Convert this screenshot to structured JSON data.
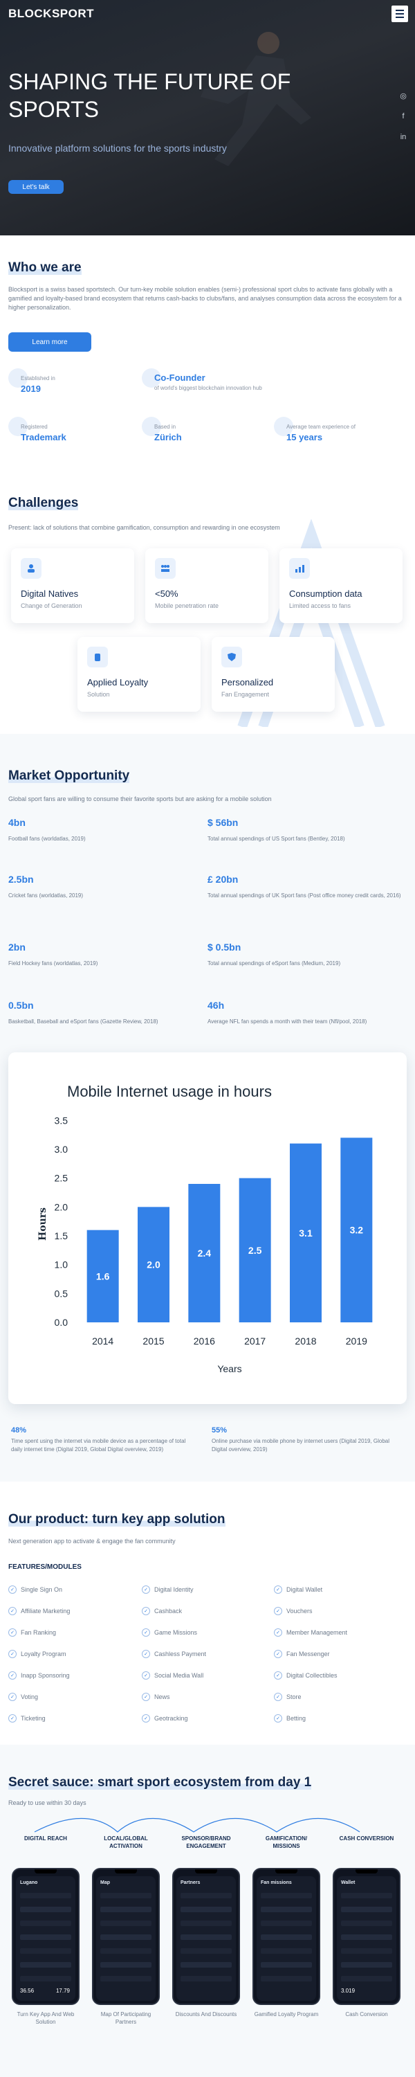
{
  "brand": {
    "logo": "BLOCKSPORT"
  },
  "hero": {
    "title": "SHAPING THE FUTURE OF SPORTS",
    "subtitle": "Innovative platform solutions for the sports industry",
    "cta": "Let's talk"
  },
  "about": {
    "title": "Who we are",
    "body": "Blocksport is a swiss based sportstech. Our turn-key mobile solution enables (semi-) professional sport clubs to activate fans globally with a gamified and loyalty-based brand ecosystem that returns cash-backs to clubs/fans, and analyses consumption data across the ecosystem for a higher personalization.",
    "cta": "Learn more",
    "stats": [
      {
        "label": "Established in",
        "value": "2019"
      },
      {
        "label": "Co-Founder",
        "value": "of world's biggest blockchain innovation hub"
      },
      {
        "label": "Registered",
        "value": "Trademark"
      },
      {
        "label": "Based in",
        "value": "Zürich"
      },
      {
        "label": "Average team experience of",
        "value": "15 years"
      }
    ]
  },
  "challenges": {
    "title": "Challenges",
    "intro": "Present: lack of solutions that combine gamification, consumption and rewarding in one ecosystem",
    "cards": [
      {
        "title": "Digital Natives",
        "desc": "Change of Generation"
      },
      {
        "title": "<50%",
        "desc": "Mobile penetration rate"
      },
      {
        "title": "Consumption data",
        "desc": "Limited access to fans"
      },
      {
        "title": "Applied Loyalty",
        "desc": "Solution"
      },
      {
        "title": "Personalized",
        "desc": "Fan Engagement"
      }
    ]
  },
  "market": {
    "title": "Market Opportunity",
    "intro": "Global sport fans are willing to consume their favorite sports but are asking for a mobile solution",
    "left": [
      {
        "value": "4bn",
        "desc": "Football fans (worldatlas, 2019)"
      },
      {
        "value": "2.5bn",
        "desc": "Cricket fans (worldatlas, 2019)"
      },
      {
        "value": "2bn",
        "desc": "Field Hockey fans (worldatlas, 2019)"
      },
      {
        "value": "0.5bn",
        "desc": "Basketball, Baseball and eSport fans (Gazette Review, 2018)"
      }
    ],
    "right": [
      {
        "value": "$ 56bn",
        "desc": "Total annual spendings of US Sport fans (Bentley, 2018)"
      },
      {
        "value": "£ 20bn",
        "desc": "Total annual spendings of UK Sport fans (Post office money credit cards, 2016)"
      },
      {
        "value": "$ 0.5bn",
        "desc": "Total annual spendings of eSport fans (Medium, 2019)"
      },
      {
        "value": "46h",
        "desc": "Average NFL fan spends a month with their team (Nfl/pool, 2018)"
      }
    ],
    "bottom": [
      {
        "value": "48%",
        "desc": "Time spent using the internet via mobile device as a percentage of total daily internet time (Digital 2019, Global Digital overview, 2019)"
      },
      {
        "value": "55%",
        "desc": "Online purchase via mobile phone by internet users (Digital 2019, Global Digital overview, 2019)"
      }
    ]
  },
  "chart_data": {
    "type": "bar",
    "title": "Mobile Internet usage in hours",
    "xlabel": "Years",
    "ylabel": "Hours",
    "categories": [
      "2014",
      "2015",
      "2016",
      "2017",
      "2018",
      "2019"
    ],
    "values": [
      1.6,
      2.0,
      2.4,
      2.5,
      3.1,
      3.2
    ],
    "data_labels": [
      "1.6",
      "2.0",
      "2.4",
      "2.5",
      "3.1",
      "3.2"
    ],
    "yticks": [
      "0.0",
      "0.5",
      "1.0",
      "1.5",
      "2.0",
      "2.5",
      "3.0",
      "3.5"
    ],
    "ylim": [
      0,
      3.6
    ],
    "bar_color": "#3381e8",
    "grid": false
  },
  "product": {
    "title": "Our product: turn key app solution",
    "intro": "Next generation app to activate & engage the fan community",
    "features_title": "FEATURES/MODULES",
    "col1": [
      "Single Sign On",
      "Affiliate Marketing",
      "Fan Ranking",
      "Loyalty Program",
      "Inapp Sponsoring",
      "Voting",
      "Ticketing"
    ],
    "col2": [
      "Digital Identity",
      "Cashback",
      "Game Missions",
      "Cashless Payment",
      "Social Media Wall",
      "News",
      "Geotracking"
    ],
    "col3": [
      "Digital Wallet",
      "Vouchers",
      "Member Management",
      "Fan Messenger",
      "Digital Collectibles",
      "Store",
      "Betting"
    ]
  },
  "sauce": {
    "title": "Secret sauce: smart sport ecosystem from day 1",
    "intro": "Ready to use within 30 days",
    "steps": [
      "DIGITAL REACH",
      "LOCAL/GLOBAL ACTIVATION",
      "SPONSOR/BRAND ENGAGEMENT",
      "GAMIFICATION/ MISSIONS",
      "CASH CONVERSION"
    ],
    "captions": [
      "Turn Key App And Web Solution",
      "Map Of Participating Partners",
      "Discounts And Discounts",
      "Gamified Loyalty Program",
      "Cash Conversion"
    ],
    "phones": [
      {
        "title": "Lugano",
        "metric": "36.56",
        "metric2": "17.79"
      },
      {
        "title": "Map",
        "metric": "",
        "metric2": ""
      },
      {
        "title": "Partners",
        "metric": "",
        "metric2": ""
      },
      {
        "title": "Fan missions",
        "metric": "",
        "metric2": ""
      },
      {
        "title": "Wallet",
        "metric": "3.019",
        "metric2": ""
      }
    ]
  },
  "colors": {
    "accent": "#2f7de1",
    "navy": "#132a4f",
    "hero_bg": "#22272e"
  }
}
